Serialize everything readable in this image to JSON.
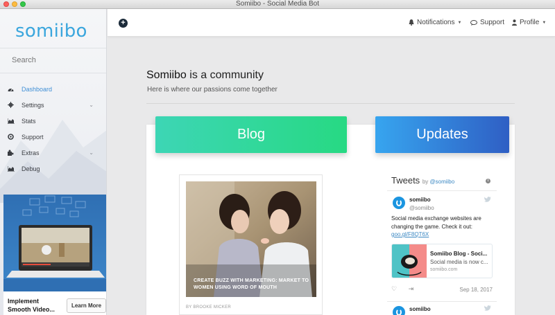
{
  "window": {
    "title": "Somiibo - Social Media Bot"
  },
  "sidebar": {
    "logo": "somiibo",
    "search_placeholder": "Search",
    "items": [
      {
        "label": "Dashboard",
        "icon": "dashboard-icon",
        "active": true
      },
      {
        "label": "Settings",
        "icon": "gear-icon",
        "has_submenu": true
      },
      {
        "label": "Stats",
        "icon": "area-chart-icon"
      },
      {
        "label": "Support",
        "icon": "life-ring-icon"
      },
      {
        "label": "Extras",
        "icon": "puzzle-icon",
        "has_submenu": true
      },
      {
        "label": "Debug",
        "icon": "area-chart-icon"
      }
    ],
    "ad": {
      "text": "Implement Smooth Video...",
      "button": "Learn More"
    }
  },
  "header": {
    "notifications": "Notifications",
    "support": "Support",
    "profile": "Profile"
  },
  "main": {
    "title_brand": "Somiibo",
    "title_rest": " is a community",
    "subtitle": "Here is where our passions come together",
    "blog_button": "Blog",
    "updates_button": "Updates",
    "post": {
      "caption": "CREATE BUZZ WITH MARKETING: MARKET TO WOMEN USING WORD OF MOUTH",
      "author": "BY BROOKE MICKER"
    }
  },
  "tweets": {
    "title": "Tweets",
    "by": "by",
    "by_handle": "@somiibo",
    "items": [
      {
        "name": "somiibo",
        "handle": "@somiibo",
        "text": "Social media exchange websites are changing the game. Check it out:",
        "link": "goo.gl/F8QT6X",
        "card_title": "Somiibo Blog - Soci...",
        "card_desc": "Social media is now c...",
        "card_url": "somiibo.com",
        "date": "Sep 18, 2017"
      },
      {
        "name": "somiibo"
      }
    ]
  },
  "colors": {
    "brand_blue": "#3aa6dd",
    "blog_gradient": [
      "#3dd6b5",
      "#27d983"
    ],
    "updates_gradient": [
      "#37a5ef",
      "#2f5fc4"
    ],
    "active_nav": "#3f8fd6"
  }
}
